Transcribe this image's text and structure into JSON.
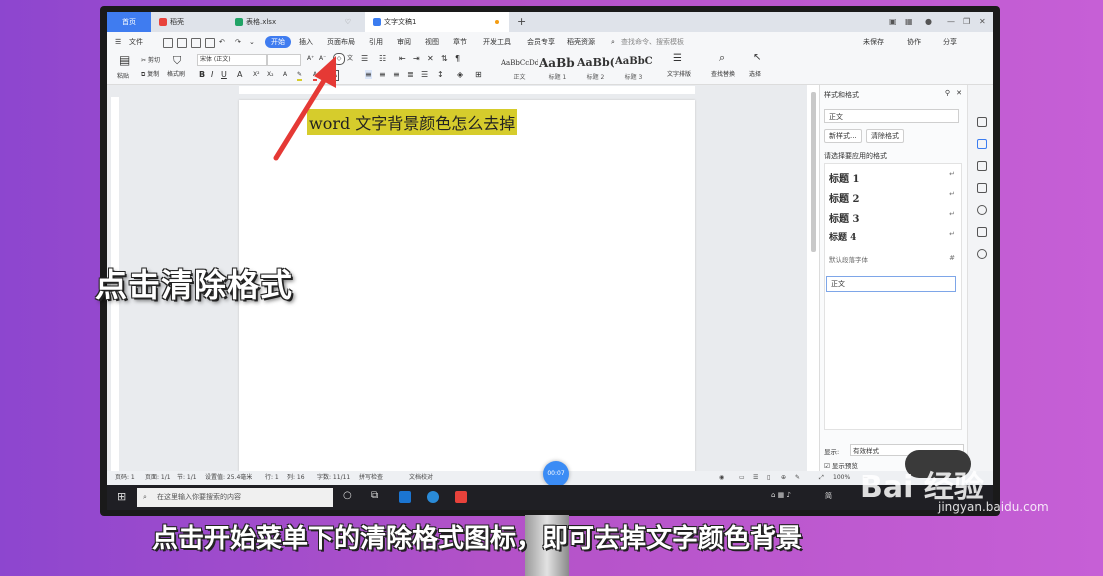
{
  "tabs": {
    "home": "首页",
    "items": [
      {
        "label": "稻壳",
        "icon_color": "#e8423b"
      },
      {
        "label": "表格.xlsx",
        "icon_color": "#21a366"
      },
      {
        "label": "文字文稿1",
        "icon_color": "#3b7cf0"
      }
    ],
    "add": "+"
  },
  "menu": {
    "file": "文件",
    "items": [
      "开始",
      "插入",
      "页面布局",
      "引用",
      "审阅",
      "视图",
      "章节",
      "开发工具",
      "会员专享",
      "稻壳资源"
    ],
    "search_placeholder": "查找命令、搜索模板",
    "right": [
      "未保存",
      "协作",
      "分享"
    ]
  },
  "ribbon": {
    "clipboard": [
      "剪切",
      "复制",
      "格式刷"
    ],
    "paste": "粘贴",
    "font_name": "宋体 (正文)",
    "font_size": "",
    "styles": [
      {
        "sample": "AaBbCcDd",
        "name": "正文"
      },
      {
        "sample": "AaBb",
        "name": "标题 1"
      },
      {
        "sample": "AaBb(",
        "name": "标题 2"
      },
      {
        "sample": "AaBbC",
        "name": "标题 3"
      }
    ],
    "text_layout": "文字排版",
    "find_replace": "查找替换",
    "select": "选择"
  },
  "document": {
    "text": "word 文字背景颜色怎么去掉",
    "highlight_color": "#d6cc2c"
  },
  "panel": {
    "title": "样式和格式",
    "current_style": "正文",
    "new_style": "新样式...",
    "clear_format": "清除格式",
    "apply_label": "请选择要应用的格式",
    "styles": [
      "标题 1",
      "标题 2",
      "标题 3",
      "标题 4"
    ],
    "default_font": "默认段落字体",
    "normal": "正文",
    "show_label": "显示:",
    "show_value": "有效样式",
    "preview": "显示预览"
  },
  "statusbar": {
    "items": [
      "页码: 1",
      "页面: 1/1",
      "节: 1/1",
      "设置值: 25.4毫米",
      "行: 1",
      "列: 16",
      "字数: 11/11",
      "拼写检查",
      "文档校对"
    ],
    "zoom": "100%",
    "timer": "00:07"
  },
  "taskbar": {
    "search": "在这里输入你要搜索的内容",
    "tray": "简"
  },
  "overlay": {
    "left_text": "点击清除格式",
    "caption": "点击开始菜单下的清除格式图标，即可去掉文字颜色背景"
  },
  "watermark": {
    "brand": "Bai 经验",
    "url": "jingyan.baidu.com"
  }
}
